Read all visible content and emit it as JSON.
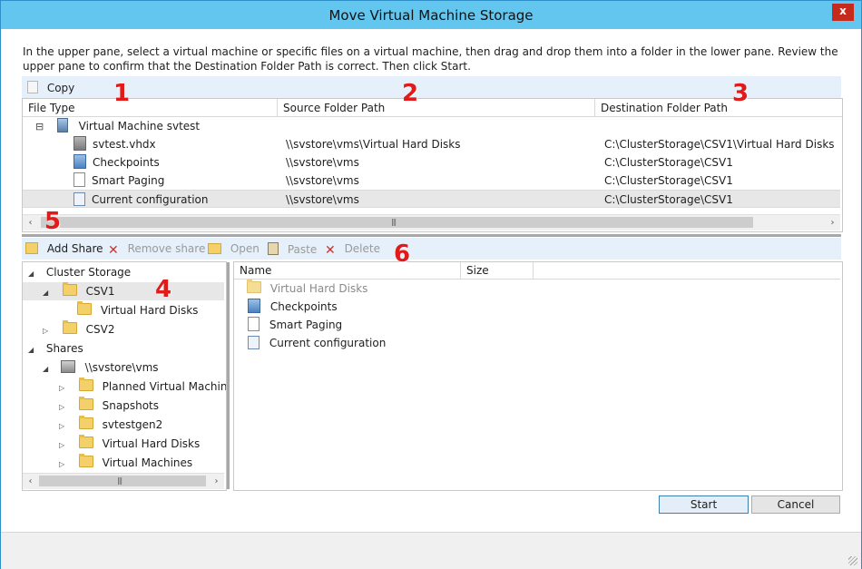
{
  "window": {
    "title": "Move Virtual Machine Storage",
    "close_label": "x"
  },
  "intro": "In the upper pane, select a virtual machine or specific files on a virtual machine, then drag and drop them into a folder in the lower pane.  Review the upper pane to confirm that the Destination Folder Path is correct. Then click Start.",
  "upper_toolbar": {
    "copy_label": "Copy"
  },
  "upper_table": {
    "columns": [
      "File Type",
      "Source Folder Path",
      "Destination Folder Path"
    ],
    "vm_name": "Virtual Machine svtest",
    "rows": [
      {
        "icon": "virtual-disk-icon",
        "name": "svtest.vhdx",
        "source": "\\\\svstore\\vms\\Virtual Hard Disks",
        "destination": "C:\\ClusterStorage\\CSV1\\Virtual Hard Disks"
      },
      {
        "icon": "checkpoint-icon",
        "name": "Checkpoints",
        "source": "\\\\svstore\\vms",
        "destination": "C:\\ClusterStorage\\CSV1"
      },
      {
        "icon": "document-icon",
        "name": "Smart Paging",
        "source": "\\\\svstore\\vms",
        "destination": "C:\\ClusterStorage\\CSV1"
      },
      {
        "icon": "configuration-icon",
        "name": "Current configuration",
        "source": "\\\\svstore\\vms",
        "destination": "C:\\ClusterStorage\\CSV1",
        "selected": true
      }
    ]
  },
  "lower_toolbar": {
    "add_share": "Add Share",
    "remove_share": "Remove share",
    "open": "Open",
    "paste": "Paste",
    "delete": "Delete"
  },
  "tree": {
    "cluster_storage": "Cluster Storage",
    "csv1": "CSV1",
    "csv1_child": "Virtual Hard Disks",
    "csv2": "CSV2",
    "shares": "Shares",
    "share_root": "\\\\svstore\\vms",
    "share_children": [
      "Planned Virtual Machines",
      "Snapshots",
      "svtestgen2",
      "Virtual Hard Disks",
      "Virtual Machines"
    ]
  },
  "file_list": {
    "columns": [
      "Name",
      "Size"
    ],
    "items": [
      {
        "icon": "folder-icon",
        "name": "Virtual Hard Disks",
        "dimmed": true
      },
      {
        "icon": "checkpoint-icon",
        "name": "Checkpoints"
      },
      {
        "icon": "document-icon",
        "name": "Smart Paging"
      },
      {
        "icon": "configuration-icon",
        "name": "Current configuration"
      }
    ]
  },
  "buttons": {
    "start": "Start",
    "cancel": "Cancel"
  },
  "callouts": [
    "1",
    "2",
    "3",
    "4",
    "5",
    "6"
  ],
  "colors": {
    "title_bar": "#62c6ee",
    "toolbar": "#e6f0fa",
    "callout": "#e21a1a",
    "close_button": "#c42b1c"
  }
}
